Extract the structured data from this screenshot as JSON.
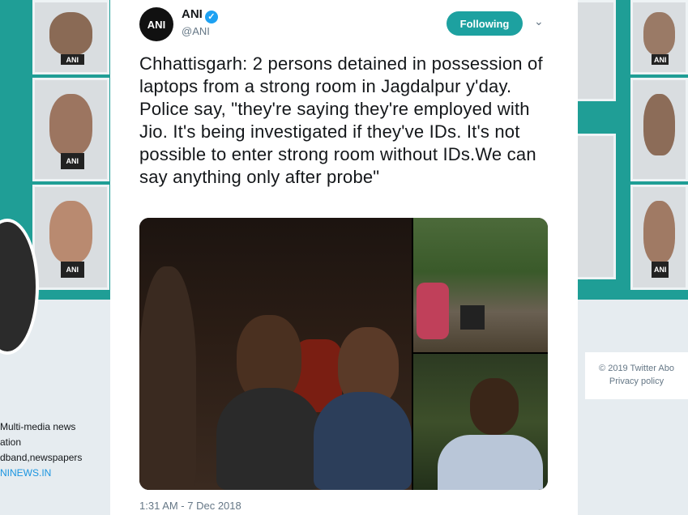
{
  "background": {
    "bio_lines": [
      "Multi-media news",
      "ation",
      "dband,newspapers"
    ],
    "bio_link": "NINEWS.IN",
    "footer_line1": "© 2019 Twitter  Abo",
    "footer_line2": "Privacy policy",
    "mic_label": "ANI"
  },
  "tweet": {
    "avatar_text": "ANI",
    "author_name": "ANI",
    "verified_glyph": "✓",
    "handle": "@ANI",
    "follow_label": "Following",
    "menu_caret": "⌄",
    "text": "Chhattisgarh: 2 persons detained in possession of laptops from a strong room in Jagdalpur y'day. Police say, \"they're saying they're employed with Jio. It's being investigated if they've IDs. It's not possible to enter strong room without IDs.We can say anything only after probe\"",
    "timestamp": "1:31 AM - 7 Dec 2018"
  },
  "colors": {
    "banner": "#1f9e96",
    "follow_button": "#1da1a0",
    "verified": "#1da1f2",
    "link": "#1b95e0"
  }
}
